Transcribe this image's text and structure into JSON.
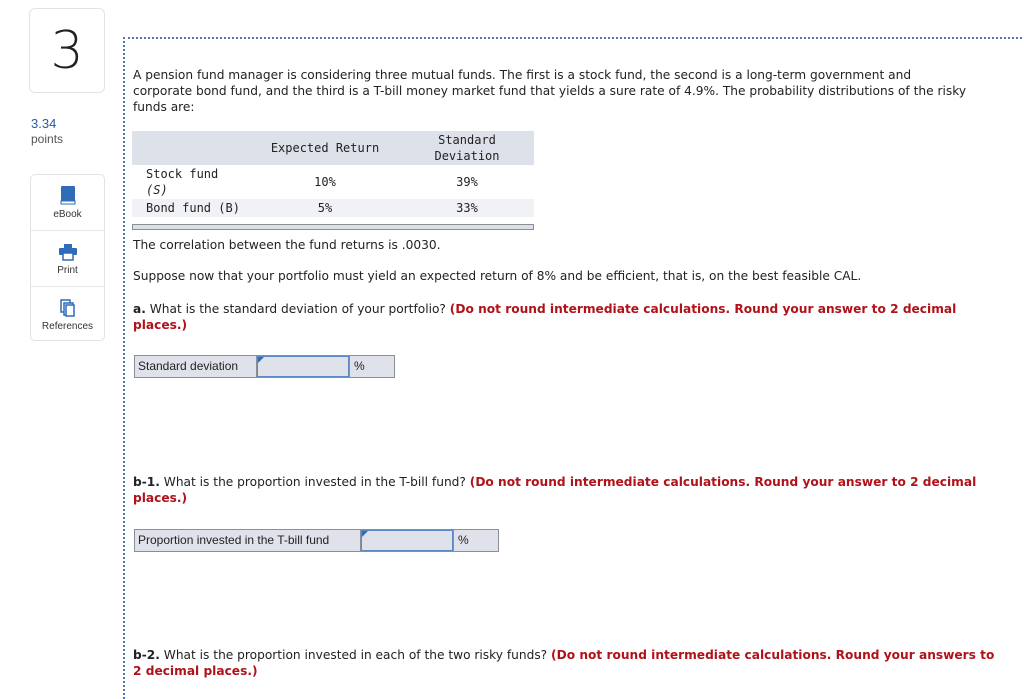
{
  "question": {
    "number": "3",
    "points_value": "3.34",
    "points_label": "points"
  },
  "tools": [
    {
      "label": "eBook",
      "icon": "book-icon"
    },
    {
      "label": "Print",
      "icon": "printer-icon"
    },
    {
      "label": "References",
      "icon": "references-icon"
    }
  ],
  "intro": {
    "line1": "A pension fund manager is considering three mutual funds. The first is a stock fund, the second is a long-term government and",
    "line2": "corporate bond fund, and the third is a T-bill money market fund that yields a sure rate of 4.9%. The probability distributions of the risky",
    "line3": "funds are:"
  },
  "table": {
    "headers": [
      "",
      "Expected Return",
      "Standard Deviation"
    ],
    "header_sd_line1": "Standard",
    "header_sd_line2": "Deviation",
    "rows": [
      {
        "name_line1": "Stock fund",
        "name_line2": "(S)",
        "expected_return": "10%",
        "std_dev": "39%"
      },
      {
        "name": "Bond fund (B)",
        "expected_return": "5%",
        "std_dev": "33%"
      }
    ]
  },
  "correlation_text": "The correlation between the fund returns is .0030.",
  "suppose_text": "Suppose now that your portfolio must yield an expected return of 8% and be efficient, that is, on the best feasible CAL.",
  "part_a": {
    "prefix": "a.",
    "question": " What is the standard deviation of your portfolio? ",
    "instruction_line1": "(Do not round intermediate calculations. Round your answer to 2 decimal",
    "instruction_line2": "places.)",
    "answer_label": "Standard deviation",
    "answer_value": "",
    "unit": "%"
  },
  "part_b1": {
    "prefix": "b-1.",
    "question": " What is the proportion invested in the T-bill fund? ",
    "instruction_line1": "(Do not round intermediate calculations. Round your answer to 2 decimal",
    "instruction_line2": "places.)",
    "answer_label": "Proportion invested in the T-bill fund",
    "answer_value": "",
    "unit": "%"
  },
  "part_b2": {
    "prefix": "b-2.",
    "question": " What is the proportion invested in each of the two risky funds? ",
    "instruction_line1": "(Do not round intermediate calculations. Round your answers to",
    "instruction_line2": "2 decimal places.)"
  },
  "colors": {
    "accent_blue": "#2c5aa0",
    "instruction_red": "#b0121a",
    "table_header_bg": "#dde1ea"
  }
}
